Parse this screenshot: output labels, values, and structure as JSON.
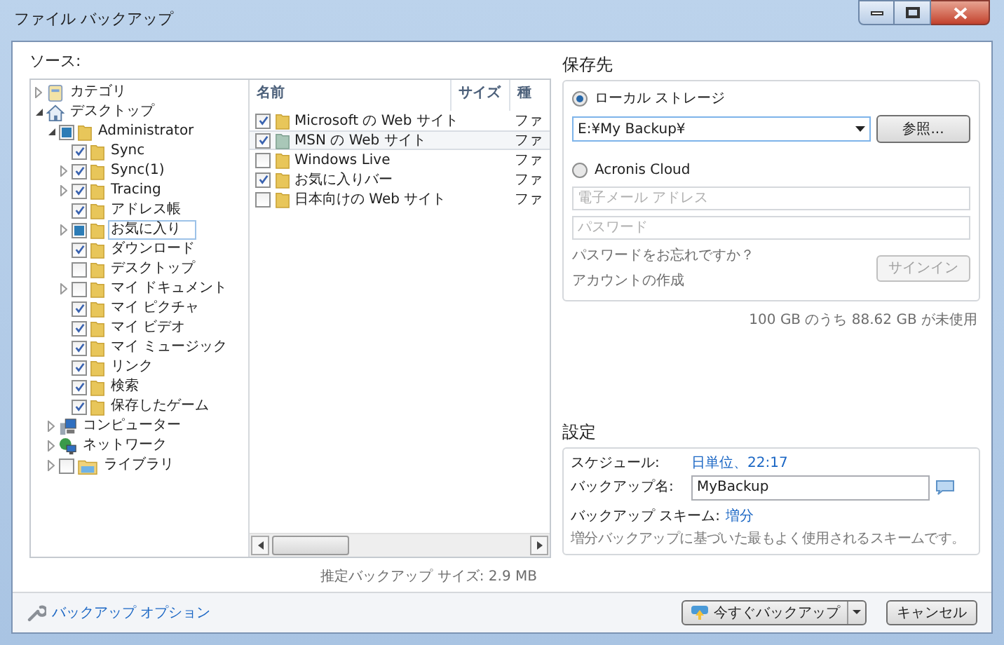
{
  "window": {
    "title": "ファイル バックアップ"
  },
  "source": {
    "label": "ソース:",
    "tree": [
      {
        "label": "カテゴリ",
        "kind": "category",
        "expanded": false,
        "selected": false
      },
      {
        "label": "デスクトップ",
        "kind": "home",
        "expanded": true,
        "selected": false,
        "children": [
          {
            "label": "Administrator",
            "kind": "folder",
            "expanded": true,
            "checked": false,
            "partial": true,
            "selected": false,
            "children": [
              {
                "label": "Sync",
                "kind": "folder",
                "checked": true,
                "partial": false,
                "selected": false
              },
              {
                "label": "Sync(1)",
                "kind": "folder",
                "expanded": false,
                "checked": true,
                "partial": false,
                "selected": false
              },
              {
                "label": "Tracing",
                "kind": "folder",
                "expanded": false,
                "checked": true,
                "partial": false,
                "selected": false
              },
              {
                "label": "アドレス帳",
                "kind": "folder",
                "checked": true,
                "partial": false,
                "selected": false
              },
              {
                "label": "お気に入り",
                "kind": "folder",
                "expanded": false,
                "checked": false,
                "partial": true,
                "selected": true
              },
              {
                "label": "ダウンロード",
                "kind": "folder",
                "checked": true,
                "partial": false,
                "selected": false
              },
              {
                "label": "デスクトップ",
                "kind": "folder",
                "checked": false,
                "partial": false,
                "selected": false
              },
              {
                "label": "マイ ドキュメント",
                "kind": "folder",
                "expanded": false,
                "checked": false,
                "partial": false,
                "selected": false
              },
              {
                "label": "マイ ピクチャ",
                "kind": "folder",
                "checked": true,
                "partial": false,
                "selected": false
              },
              {
                "label": "マイ ビデオ",
                "kind": "folder",
                "checked": true,
                "partial": false,
                "selected": false
              },
              {
                "label": "マイ ミュージック",
                "kind": "folder",
                "checked": true,
                "partial": false,
                "selected": false
              },
              {
                "label": "リンク",
                "kind": "folder",
                "checked": true,
                "partial": false,
                "selected": false
              },
              {
                "label": "検索",
                "kind": "folder",
                "checked": true,
                "partial": false,
                "selected": false
              },
              {
                "label": "保存したゲーム",
                "kind": "folder",
                "checked": true,
                "partial": false,
                "selected": false
              }
            ]
          },
          {
            "label": "コンピューター",
            "kind": "computer",
            "expanded": false,
            "selected": false
          },
          {
            "label": "ネットワーク",
            "kind": "network",
            "expanded": false,
            "selected": false
          },
          {
            "label": "ライブラリ",
            "kind": "library",
            "expanded": false,
            "checked": false,
            "partial": false,
            "selected": false
          }
        ]
      }
    ],
    "file_list": {
      "columns": [
        "名前",
        "サイズ",
        "種"
      ],
      "rows": [
        {
          "name": "Microsoft の Web サイト",
          "type": "ファ",
          "checked": true,
          "selected": false
        },
        {
          "name": "MSN の Web サイト",
          "type": "ファ",
          "checked": true,
          "selected": true
        },
        {
          "name": "Windows Live",
          "type": "ファ",
          "checked": false,
          "selected": false
        },
        {
          "name": "お気に入りバー",
          "type": "ファ",
          "checked": true,
          "selected": false
        },
        {
          "name": "日本向けの Web サイト",
          "type": "ファ",
          "checked": false,
          "selected": false
        }
      ]
    },
    "estimated_size": "推定バックアップ サイズ: 2.9 MB"
  },
  "destination": {
    "heading": "保存先",
    "options": [
      {
        "label": "ローカル ストレージ",
        "selected": true
      },
      {
        "label": "Acronis Cloud",
        "selected": false
      }
    ],
    "path": "E:¥My Backup¥",
    "browse_button": "参照...",
    "email": {
      "placeholder": "電子メール アドレス"
    },
    "password": {
      "placeholder": "パスワード"
    },
    "forgot_link": "パスワードをお忘れですか？",
    "create_account": "アカウントの作成",
    "sign_in": {
      "label": "サインイン",
      "disabled": true
    },
    "free_space": "100 GB のうち 88.62 GB が未使用"
  },
  "settings": {
    "heading": "設定",
    "schedule_label": "スケジュール:",
    "schedule_value": "日単位、22:17",
    "name_label": "バックアップ名:",
    "name_value": "MyBackup",
    "scheme_label": "バックアップ スキーム:",
    "scheme_value": "増分",
    "scheme_description": "増分バックアップに基づいた最もよく使用されるスキームです。"
  },
  "footer": {
    "options_link": "バックアップ オプション",
    "backup_button": "今すぐバックアップ",
    "cancel_button": "キャンセル"
  }
}
